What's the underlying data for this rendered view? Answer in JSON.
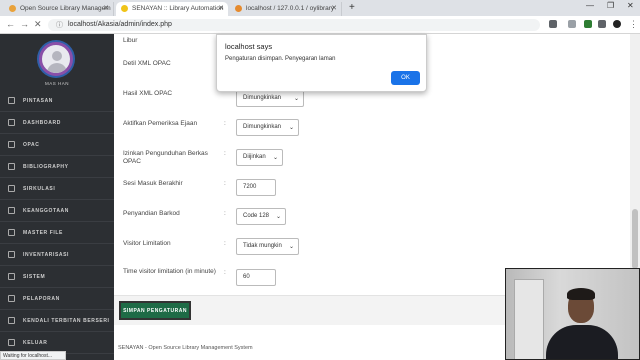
{
  "browser": {
    "tabs": [
      {
        "label": "Open Source Library Managem",
        "active": false
      },
      {
        "label": "SENAYAN :: Library Automation",
        "active": true
      },
      {
        "label": "localhost / 127.0.0.1 / oylibrary",
        "active": false
      }
    ],
    "url": "localhost/Akasia/admin/index.php",
    "status": "Waiting for localhost..."
  },
  "sidebar": {
    "username": "MAS HAN",
    "items": [
      {
        "label": "PINTASAN"
      },
      {
        "label": "DASHBOARD"
      },
      {
        "label": "OPAC"
      },
      {
        "label": "BIBLIOGRAPHY"
      },
      {
        "label": "SIRKULASI"
      },
      {
        "label": "KEANGGOTAAN"
      },
      {
        "label": "MASTER FILE"
      },
      {
        "label": "INVENTARISASI"
      },
      {
        "label": "SISTEM"
      },
      {
        "label": "PELAPORAN"
      },
      {
        "label": "KENDALI TERBITAN BERSERI"
      },
      {
        "label": "KELUAR"
      }
    ]
  },
  "settings": {
    "rows": [
      {
        "label": "Libur",
        "colon": "",
        "control": "none",
        "value": ""
      },
      {
        "label": "Detil XML OPAC",
        "colon": "",
        "control": "none",
        "value": ""
      },
      {
        "label": "Hasil XML OPAC",
        "colon": "",
        "control": "select",
        "value": "Dimungkinkan"
      },
      {
        "label": "Aktifkan Pemeriksa Ejaan",
        "colon": ":",
        "control": "select",
        "value": "Dimungkinkan"
      },
      {
        "label": "Izinkan Pengunduhan Berkas OPAC",
        "colon": ":",
        "control": "select",
        "value": "Diijinkan"
      },
      {
        "label": "Sesi Masuk Berakhir",
        "colon": ":",
        "control": "text",
        "value": "7200"
      },
      {
        "label": "Penyandian Barkod",
        "colon": ":",
        "control": "select",
        "value": "Code 128"
      },
      {
        "label": "Visitor Limitation",
        "colon": ":",
        "control": "select",
        "value": "Tidak mungkin"
      },
      {
        "label": "Time visitor limitation (in minute)",
        "colon": ":",
        "control": "text",
        "value": "60"
      }
    ],
    "save_label": "SIMPAN PENGATURAN",
    "footer": "SENAYAN - Open Source Library Management System"
  },
  "dialog": {
    "title": "localhost says",
    "message": "Pengaturan disimpan. Penyegaran laman",
    "ok_label": "OK"
  },
  "colors": {
    "sidebar_bg": "#2c2f33",
    "save_button": "#1e6b46",
    "dialog_ok": "#1a73e8"
  }
}
